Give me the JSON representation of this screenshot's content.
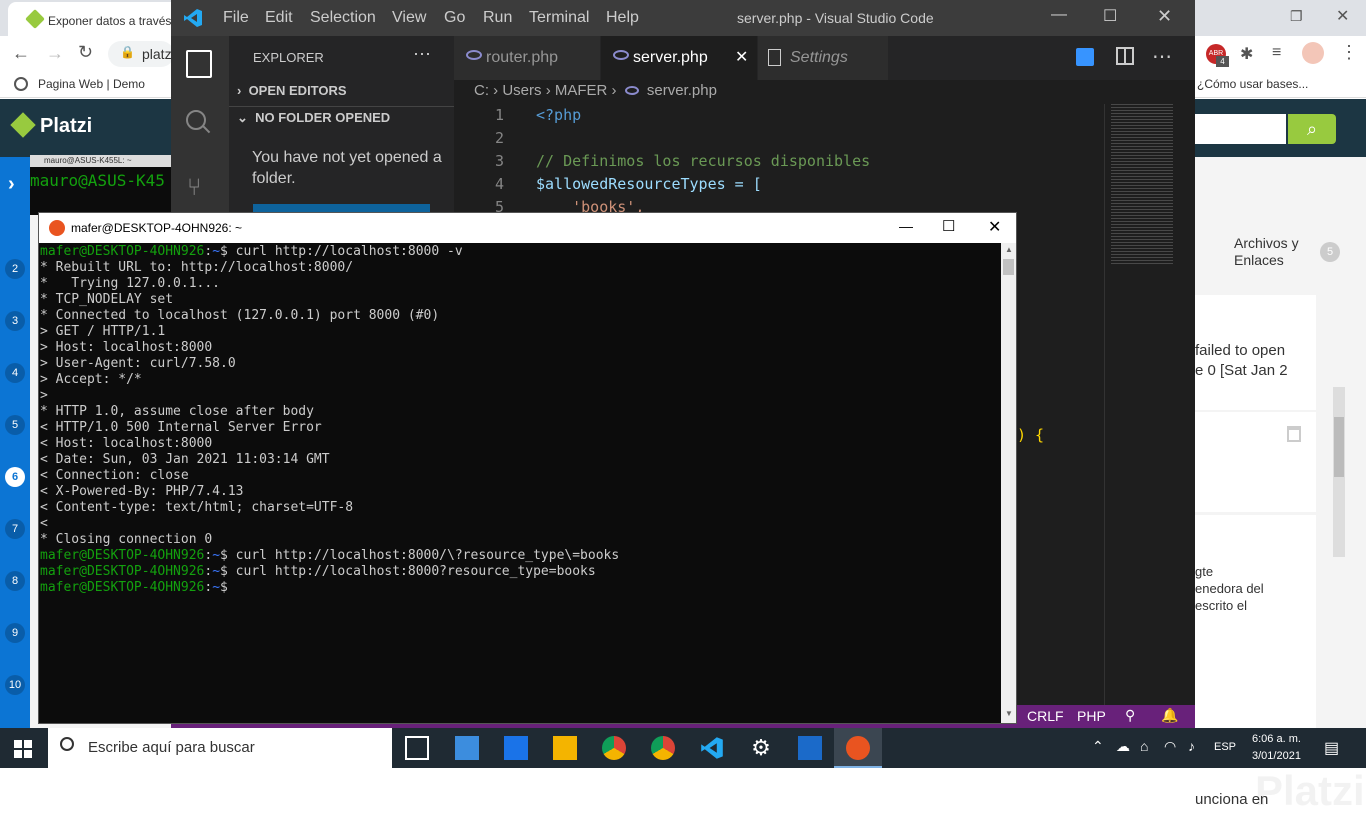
{
  "browser": {
    "tab_title": "Exponer datos a través d",
    "address": "platz",
    "bookmarks": [
      "Pagina Web | Demo"
    ],
    "bookmark_right": "¿Cómo usar bases...",
    "ext_badge": "4",
    "ext_label": "ABR"
  },
  "platzi": {
    "logo": "Platzi",
    "nav_numbers": [
      "2",
      "3",
      "4",
      "5",
      "6",
      "7",
      "8",
      "9",
      "10"
    ],
    "active_nav": "6",
    "side_title": "Archivos y Enlaces",
    "side_count": "5",
    "comment1": "failed to open\ne 0 [Sat Jan 2",
    "comment2": "gte\nenedora del\nescrito el",
    "comment3": "unciona en",
    "watermark": "Platzi"
  },
  "vscode": {
    "menu": [
      "File",
      "Edit",
      "Selection",
      "View",
      "Go",
      "Run",
      "Terminal",
      "Help"
    ],
    "title": "server.php - Visual Studio Code",
    "explorer_title": "EXPLORER",
    "open_editors": "OPEN EDITORS",
    "no_folder": "NO FOLDER OPENED",
    "no_folder_msg": "You have not yet opened a folder.",
    "tabs": [
      {
        "label": "router.php",
        "active": false
      },
      {
        "label": "server.php",
        "active": true
      },
      {
        "label": "Settings",
        "active": false
      }
    ],
    "breadcrumb": [
      "C:",
      "Users",
      "MAFER",
      "server.php"
    ],
    "code_lines": [
      {
        "n": "1",
        "text": "<?php"
      },
      {
        "n": "2",
        "text": ""
      },
      {
        "n": "3",
        "text": "// Definimos los recursos disponibles"
      },
      {
        "n": "4",
        "text": "$allowedResourceTypes = ["
      },
      {
        "n": "5",
        "text": "    'books',"
      }
    ],
    "code_fragment": ") {",
    "status": {
      "eol": "CRLF",
      "lang": "PHP"
    }
  },
  "terminal": {
    "title": "mafer@DESKTOP-4OHN926: ~",
    "behind_title": "mauro@ASUS-K455L: ~",
    "behind_prompt": "mauro@ASUS-K45",
    "prompt_user": "mafer@DESKTOP-4OHN926",
    "prompt_path": "~",
    "lines": [
      {
        "type": "cmd",
        "text": " curl http://localhost:8000 -v"
      },
      {
        "type": "out",
        "text": "* Rebuilt URL to: http://localhost:8000/"
      },
      {
        "type": "out",
        "text": "*   Trying 127.0.0.1..."
      },
      {
        "type": "out",
        "text": "* TCP_NODELAY set"
      },
      {
        "type": "out",
        "text": "* Connected to localhost (127.0.0.1) port 8000 (#0)"
      },
      {
        "type": "out",
        "text": "> GET / HTTP/1.1"
      },
      {
        "type": "out",
        "text": "> Host: localhost:8000"
      },
      {
        "type": "out",
        "text": "> User-Agent: curl/7.58.0"
      },
      {
        "type": "out",
        "text": "> Accept: */*"
      },
      {
        "type": "out",
        "text": ">"
      },
      {
        "type": "out",
        "text": "* HTTP 1.0, assume close after body"
      },
      {
        "type": "out",
        "text": "< HTTP/1.0 500 Internal Server Error"
      },
      {
        "type": "out",
        "text": "< Host: localhost:8000"
      },
      {
        "type": "out",
        "text": "< Date: Sun, 03 Jan 2021 11:03:14 GMT"
      },
      {
        "type": "out",
        "text": "< Connection: close"
      },
      {
        "type": "out",
        "text": "< X-Powered-By: PHP/7.4.13"
      },
      {
        "type": "out",
        "text": "< Content-type: text/html; charset=UTF-8"
      },
      {
        "type": "out",
        "text": "<"
      },
      {
        "type": "out",
        "text": "* Closing connection 0"
      },
      {
        "type": "cmd",
        "text": " curl http://localhost:8000/\\?resource_type\\=books"
      },
      {
        "type": "cmd",
        "text": " curl http://localhost:8000?resource_type=books"
      },
      {
        "type": "cmd",
        "text": ""
      }
    ]
  },
  "taskbar": {
    "search_placeholder": "Escribe aquí para buscar",
    "lang": "ESP",
    "time": "6:06 a. m.",
    "date": "3/01/2021"
  },
  "colors": {
    "vscode_status": "#68217a",
    "platzi_green": "#98ca3f",
    "platzi_dark": "#1c3643",
    "term_green": "#13a10e",
    "term_blue": "#3b78ff"
  }
}
